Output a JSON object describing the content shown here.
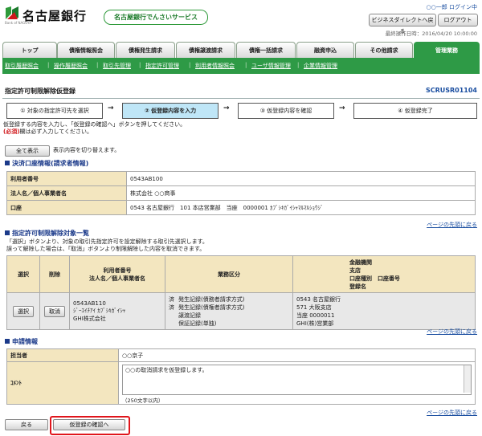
{
  "header": {
    "bank_name": "名古屋銀行",
    "logo_sub": "Bank of NAGOYA",
    "service_name": "名古屋銀行でんさいサービス",
    "user_text": "○○一郎 ログイン中",
    "btn_business_direct": "ビジネスダイレクトへ戻る",
    "btn_logout": "ログアウト",
    "last_operation": "最終操作日時：2016/04/20 10:00:00"
  },
  "tabs": [
    {
      "label": "トップ"
    },
    {
      "label": "債権情報照会"
    },
    {
      "label": "債権発生請求"
    },
    {
      "label": "債権譲渡請求"
    },
    {
      "label": "債権一括請求"
    },
    {
      "label": "融資申込"
    },
    {
      "label": "その他請求"
    },
    {
      "label": "管理業務"
    }
  ],
  "subnav": [
    {
      "label": "取引履歴照会"
    },
    {
      "label": "操作履歴照会"
    },
    {
      "label": "取引先管理"
    },
    {
      "label": "指定許可管理"
    },
    {
      "label": "利用者情報照会"
    },
    {
      "label": "ユーザ情報管理"
    },
    {
      "label": "企業情報管理"
    }
  ],
  "page": {
    "title": "指定許可制限解除仮登録",
    "code": "SCRUSR01104"
  },
  "steps": [
    {
      "label": "① 対象の指定許可先を選択"
    },
    {
      "label": "② 仮登録内容を入力"
    },
    {
      "label": "③ 仮登録内容を確認"
    },
    {
      "label": "④ 仮登録完了"
    }
  ],
  "arrow": "→",
  "instructions": {
    "line1": "仮登録する内容を入力し、「仮登録の確認へ」ボタンを押してください。",
    "required_badge": "(必須)",
    "line2": "欄は必ず入力してください。"
  },
  "show_all": {
    "button": "全て表示",
    "desc": "表示内容を切り替えます。"
  },
  "settlement": {
    "heading": "決済口座情報(請求者情報)",
    "rows": [
      {
        "label": "利用者番号",
        "value": "0543AB100"
      },
      {
        "label": "法人名／個人事業者名",
        "value": "株式会社 ○○商事"
      },
      {
        "label": "口座",
        "value": "0543 名古屋銀行　101 本店営業部　当座　0000001 ｶﾌﾞｼｷｶﾞｲｼｬﾏﾙﾏﾙｼｮｳｼﾞ"
      }
    ]
  },
  "page_top": "ページの先頭に戻る",
  "targets": {
    "heading": "指定許可制限解除対象一覧",
    "desc1": "「選択」ボタンより、対象の取引先指定許可を設定解除する取引先選択します。",
    "desc2": "誤って解除した場合は、「取消」ボタンより制限解除した内容を取消できます。",
    "headers": {
      "select": "選択",
      "delete": "削除",
      "user_no": "利用者番号",
      "name": "法人名／個人事業者名",
      "business": "業務区分",
      "bank": "金融機関",
      "branch": "支店",
      "acct": "口座種別　口座番号",
      "reg_name": "登録名"
    },
    "row": {
      "select_btn": "選択",
      "cancel_btn": "取消",
      "user_no": "0543AB110",
      "kana": "ｼﾞｰｴｲﾁｱｲ ｶﾌﾞｼｷｶﾞｲｼｬ",
      "name": "GHI株式会社",
      "business": [
        {
          "status": "済",
          "label": "発生記録(債務者請求方式)"
        },
        {
          "status": "済",
          "label": "発生記録(債権者請求方式)"
        },
        {
          "status": "",
          "label": "譲渡記録"
        },
        {
          "status": "",
          "label": "保証記録(単独)"
        }
      ],
      "bank": "0543 名古屋銀行",
      "branch": "571 大阪支店",
      "acct": "当座 0000011",
      "reg_name": "GHI(株)営業部"
    }
  },
  "application": {
    "heading": "申請情報",
    "person_label": "担当者",
    "person_value": "○○京子",
    "comment_label": "ｺﾒﾝﾄ",
    "comment_value": "○○の取消請求を仮登録します。",
    "comment_hint": "（250文字以内）"
  },
  "footer": {
    "back": "戻る",
    "confirm": "仮登録の確認へ"
  }
}
